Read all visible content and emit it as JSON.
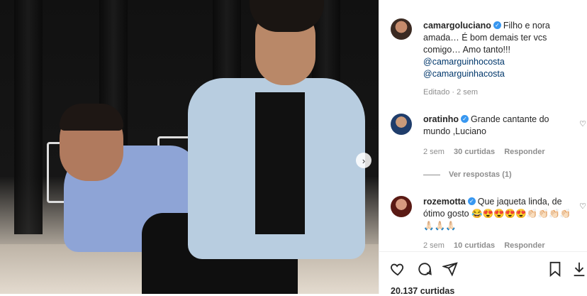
{
  "post": {
    "next_icon": "chevron-right-icon"
  },
  "caption": {
    "username": "camargoluciano",
    "text": "Filho e nora amada… É bom demais ter vcs comigo… Amo tanto!!!",
    "mention1": "@camarguinhocosta",
    "mention2": "@camarguinhacosta",
    "meta": "Editado · 2 sem"
  },
  "comments": [
    {
      "username": "oratinho",
      "text": "Grande cantante do mundo ,Luciano",
      "time": "2 sem",
      "likes": "30 curtidas",
      "reply": "Responder",
      "view_replies": "Ver respostas (1)"
    },
    {
      "username": "rozemotta",
      "text": "Que jaqueta linda, de ótimo gosto 😂😍😍😍😍👏🏻👏🏻👏🏻👏🏻",
      "text2": "🙏🏻🙏🏻🙏🏻",
      "time": "2 sem",
      "likes": "10 curtidas",
      "reply": "Responder"
    }
  ],
  "footer": {
    "likes": "20.137 curtidas"
  },
  "colors": {
    "verified": "#3897f0",
    "mention": "#00376b",
    "meta": "#8e8e8e"
  }
}
